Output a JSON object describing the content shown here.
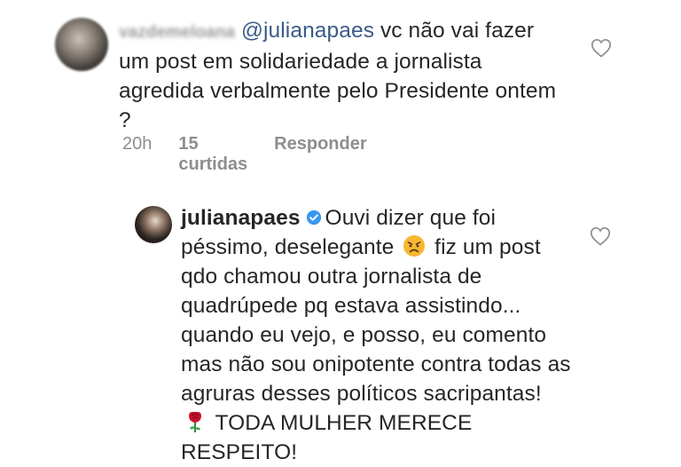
{
  "comment1": {
    "username": "vazdemeloana",
    "mention": "@julianapaes",
    "text": " vc não vai fazer um post em solidariedade a jornalista agredida verbalmente pelo Presidente ontem ?",
    "time": "20h",
    "likes": "15 curtidas",
    "reply_label": "Responder"
  },
  "comment2": {
    "username": "julianapaes",
    "text_part1": "Ouvi dizer que foi péssimo,  deselegante ",
    "text_part2": " fiz um post qdo chamou outra jornalista de quadrúpede pq estava assistindo... quando eu vejo, e posso, eu comento mas não sou onipotente contra todas as agruras desses políticos sacripantas! ",
    "text_part3": " TODA MULHER MERECE RESPEITO!"
  },
  "icons": {
    "like": "heart-icon",
    "verified": "verified-badge-icon",
    "emoji_angry": "angry-face-emoji",
    "emoji_rose": "rose-emoji"
  },
  "colors": {
    "mention": "#3b5b86",
    "meta": "#8e8e8e",
    "verified": "#3897f0"
  }
}
